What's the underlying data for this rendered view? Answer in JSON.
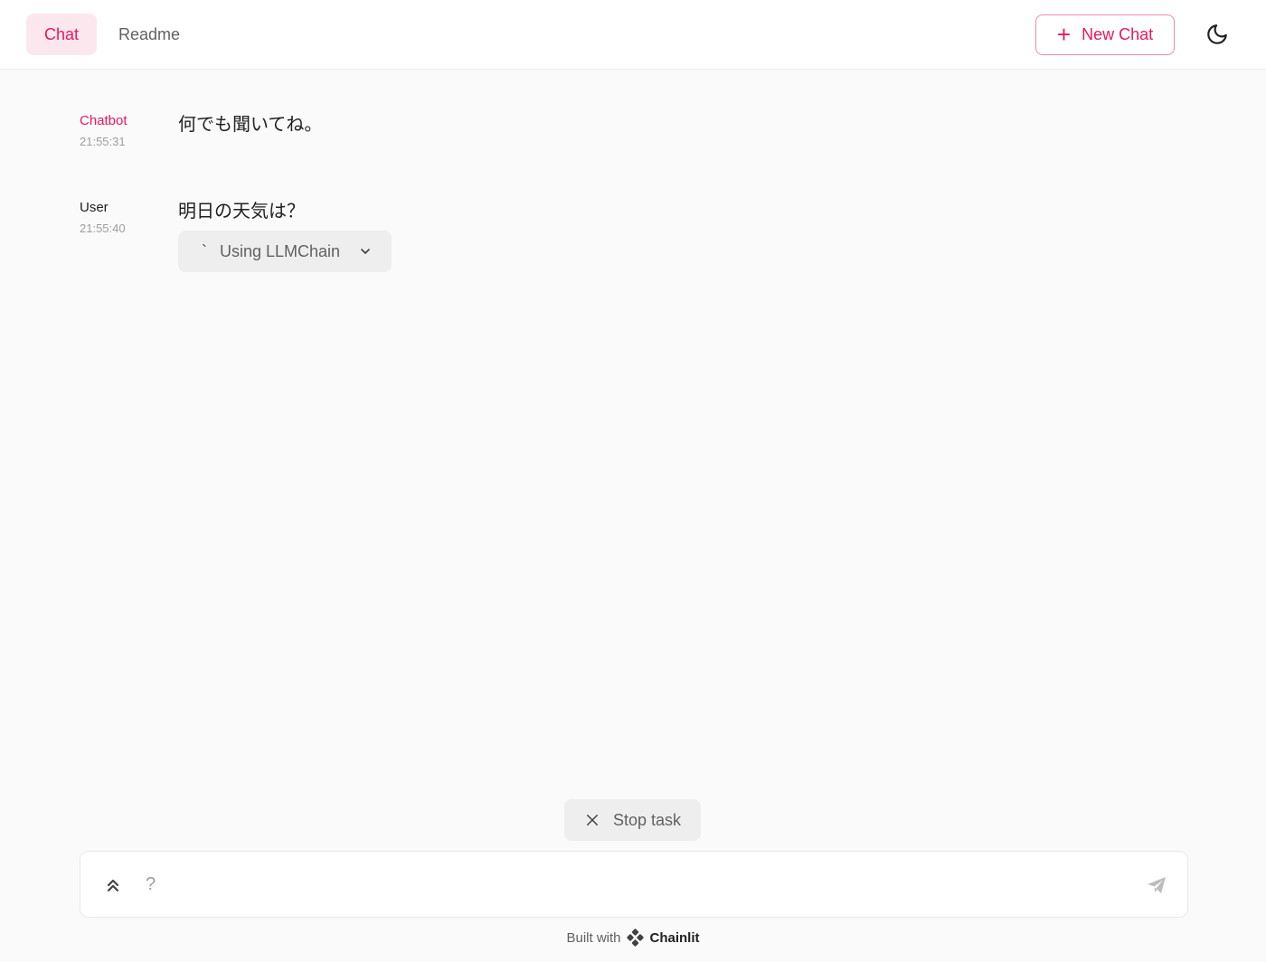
{
  "header": {
    "tabs": [
      {
        "label": "Chat",
        "active": true
      },
      {
        "label": "Readme",
        "active": false
      }
    ],
    "new_chat_label": "New Chat",
    "theme_icon": "moon-icon"
  },
  "messages": [
    {
      "author": "Chatbot",
      "time": "21:55:31",
      "content": "何でも聞いてね。"
    },
    {
      "author": "User",
      "time": "21:55:40",
      "content": "明日の天気は？"
    }
  ],
  "step": {
    "prefix": "`",
    "label": "Using LLMChain"
  },
  "stop_task_label": "Stop task",
  "composer": {
    "placeholder": "?",
    "value": ""
  },
  "footer": {
    "built_with": "Built with",
    "brand": "Chainlit"
  },
  "colors": {
    "accent": "#e8185c",
    "accent_bg": "#fde7ee",
    "background": "#fafafa"
  }
}
